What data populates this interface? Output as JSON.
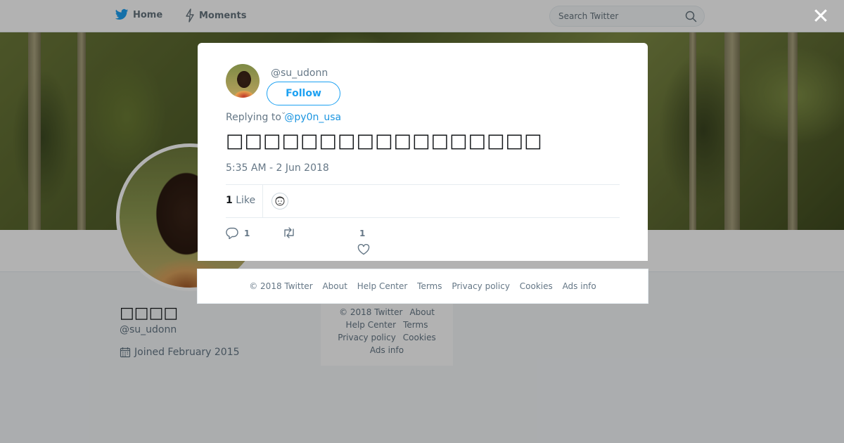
{
  "topbar": {
    "home_label": "Home",
    "moments_label": "Moments",
    "search_placeholder": "Search Twitter"
  },
  "profile": {
    "name": "□□□□",
    "handle": "@su_udonn",
    "joined": "Joined February 2015"
  },
  "side_footer": {
    "links": [
      "© 2018 Twitter",
      "About",
      "Help Center",
      "Terms",
      "Privacy policy",
      "Cookies",
      "Ads info"
    ]
  },
  "tweet": {
    "handle": "@su_udonn",
    "follow_label": "Follow",
    "replying_prefix": "Replying to",
    "replying_to": "@py0n_usa",
    "text": "□□□□□□□□□□□□□□□□□",
    "timestamp": "5:35 AM - 2 Jun 2018",
    "like_count": "1",
    "like_label": "Like",
    "reply_count": "1",
    "retweet_count": "",
    "favorite_count": "1"
  },
  "modal_footer": {
    "links": [
      "© 2018 Twitter",
      "About",
      "Help Center",
      "Terms",
      "Privacy policy",
      "Cookies",
      "Ads info"
    ]
  },
  "colors": {
    "accent": "#1da1f2",
    "link": "#1b95e0",
    "muted": "#657786"
  }
}
